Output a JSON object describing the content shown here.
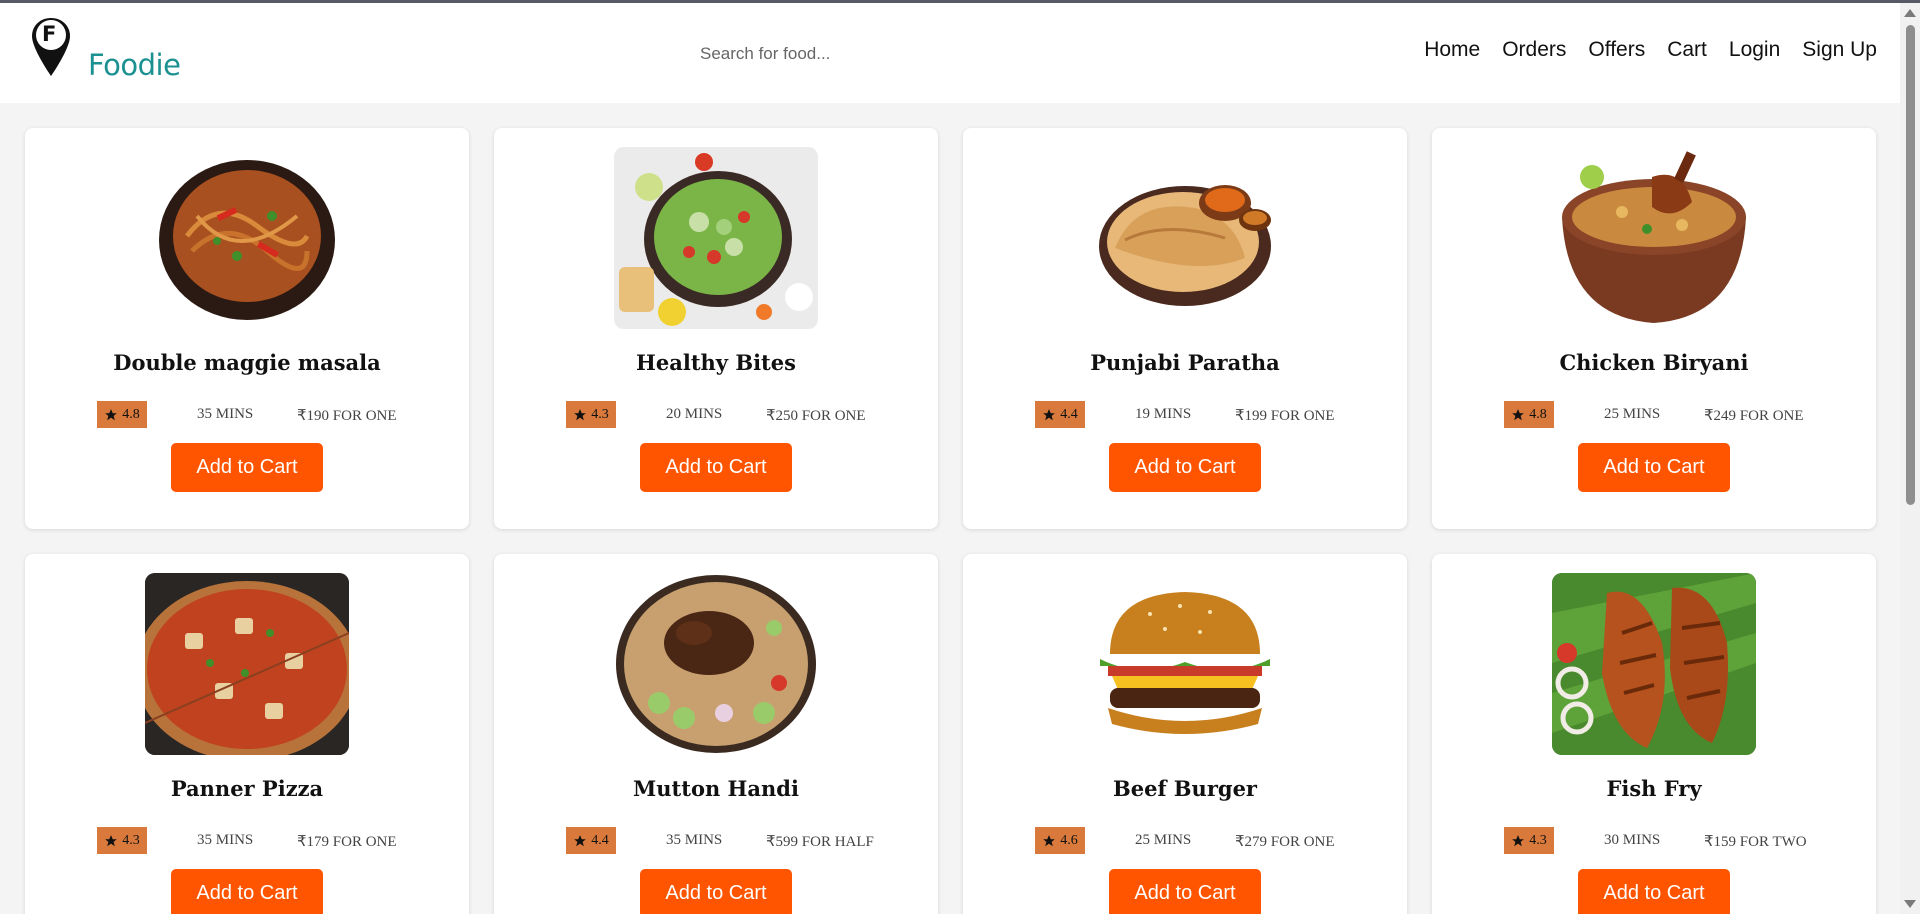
{
  "header": {
    "logo_letter": "F",
    "brand": "Foodie",
    "brand_color": "#1b9191",
    "search_placeholder": "Search for food...",
    "nav": [
      "Home",
      "Orders",
      "Offers",
      "Cart",
      "Login",
      "Sign Up"
    ]
  },
  "accent_color": "#ff5500",
  "rating_color": "#d97a3c",
  "items": [
    {
      "name": "Double maggie masala",
      "rating": "4.8",
      "time": "35 MINS",
      "price": "₹190 FOR ONE",
      "button": "Add to Cart",
      "image": "noodles-bowl"
    },
    {
      "name": "Healthy Bites",
      "rating": "4.3",
      "time": "20 MINS",
      "price": "₹250 FOR ONE",
      "button": "Add to Cart",
      "image": "salad-bowl"
    },
    {
      "name": "Punjabi Paratha",
      "rating": "4.4",
      "time": "19 MINS",
      "price": "₹199 FOR ONE",
      "button": "Add to Cart",
      "image": "paratha-plate"
    },
    {
      "name": "Chicken Biryani",
      "rating": "4.8",
      "time": "25 MINS",
      "price": "₹249 FOR ONE",
      "button": "Add to Cart",
      "image": "biryani-pot"
    },
    {
      "name": "Panner Pizza",
      "rating": "4.3",
      "time": "35 MINS",
      "price": "₹179 FOR ONE",
      "button": "Add to Cart",
      "image": "pizza"
    },
    {
      "name": "Mutton Handi",
      "rating": "4.4",
      "time": "35 MINS",
      "price": "₹599 FOR HALF",
      "button": "Add to Cart",
      "image": "mutton-platter"
    },
    {
      "name": "Beef Burger",
      "rating": "4.6",
      "time": "25 MINS",
      "price": "₹279 FOR ONE",
      "button": "Add to Cart",
      "image": "burger"
    },
    {
      "name": "Fish Fry",
      "rating": "4.3",
      "time": "30 MINS",
      "price": "₹159 FOR TWO",
      "button": "Add to Cart",
      "image": "fish-fry"
    }
  ]
}
